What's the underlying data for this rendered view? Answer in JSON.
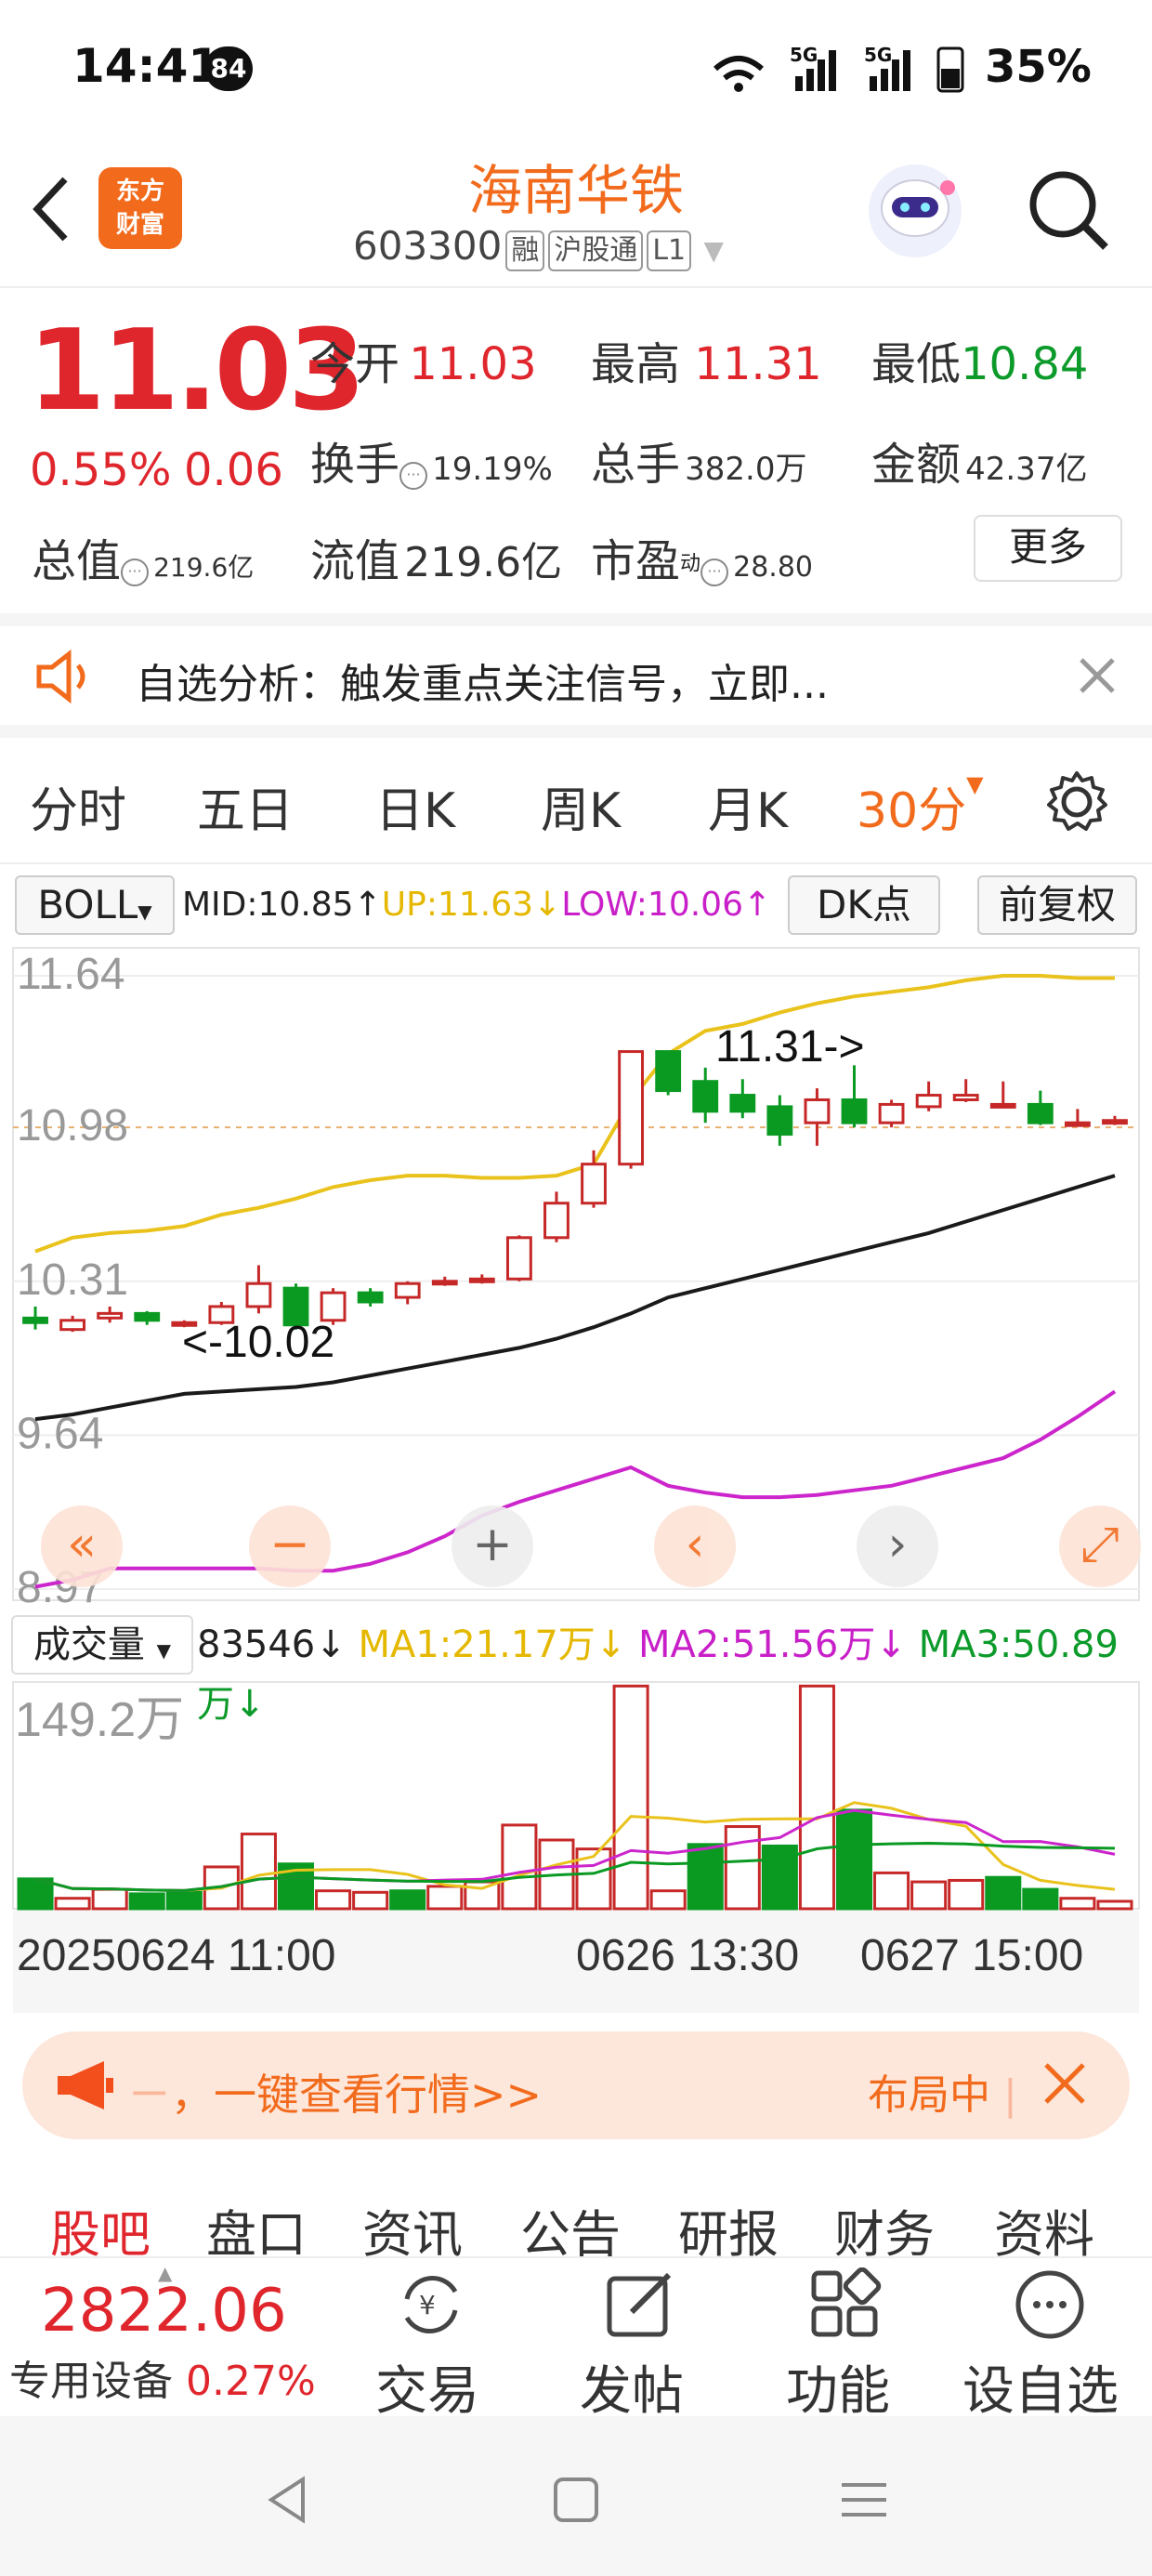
{
  "status_bar": {
    "time": "14:41",
    "notif_count": "84",
    "battery": "35%"
  },
  "header": {
    "logo_line1": "东方",
    "logo_line2": "财富",
    "name": "海南华铁",
    "code": "603300",
    "tags": [
      "融",
      "沪股通",
      "L1"
    ]
  },
  "quote": {
    "price": "11.03",
    "change_pct": "0.55%",
    "change": "0.06",
    "open_label": "今开",
    "open": "11.03",
    "high_label": "最高",
    "high": "11.31",
    "low_label": "最低",
    "low": "10.84",
    "turnover_label": "换手",
    "turnover": "19.19%",
    "volume_label": "总手",
    "volume": "382.0万",
    "amount_label": "金额",
    "amount": "42.37亿",
    "mktcap_label": "总值",
    "mktcap": "219.6亿",
    "float_label": "流值",
    "float": "219.6亿",
    "pe_label": "市盈",
    "pe_sup": "动",
    "pe": "28.80",
    "more_label": "更多"
  },
  "notice": {
    "text": "自选分析：触发重点关注信号，立即..."
  },
  "period_tabs": [
    "分时",
    "五日",
    "日K",
    "周K",
    "月K",
    "30分"
  ],
  "active_period": "30分",
  "indicator": {
    "name": "BOLL",
    "mid": "MID:10.85↑",
    "up": "UP:11.63↓",
    "low": "LOW:10.06↑",
    "dk": "DK点",
    "adjust": "前复权"
  },
  "volume_indicator": {
    "name": "成交量",
    "vol": "83546↓",
    "ma1": "MA1:21.17万↓",
    "ma2": "MA2:51.56万↓",
    "ma3": "MA3:50.89万↓",
    "max_label": "149.2万"
  },
  "chart_data": {
    "type": "candlestick",
    "y_ticks": [
      "11.64",
      "10.98",
      "10.31",
      "9.64",
      "8.97"
    ],
    "ylim": [
      8.97,
      11.64
    ],
    "annotations": [
      "11.31->",
      "<-10.02"
    ],
    "x_labels": [
      "20250624 11:00",
      "0626 13:30",
      "0627 15:00"
    ],
    "candles": [
      {
        "o": 10.15,
        "c": 10.13,
        "h": 10.2,
        "l": 10.1
      },
      {
        "o": 10.1,
        "c": 10.14,
        "h": 10.16,
        "l": 10.09
      },
      {
        "o": 10.15,
        "c": 10.17,
        "h": 10.2,
        "l": 10.13
      },
      {
        "o": 10.17,
        "c": 10.14,
        "h": 10.18,
        "l": 10.12
      },
      {
        "o": 10.13,
        "c": 10.13,
        "h": 10.14,
        "l": 10.11
      },
      {
        "o": 10.13,
        "c": 10.2,
        "h": 10.22,
        "l": 10.12
      },
      {
        "o": 10.2,
        "c": 10.3,
        "h": 10.38,
        "l": 10.17
      },
      {
        "o": 10.28,
        "c": 10.12,
        "h": 10.3,
        "l": 10.1
      },
      {
        "o": 10.14,
        "c": 10.26,
        "h": 10.28,
        "l": 10.12
      },
      {
        "o": 10.26,
        "c": 10.22,
        "h": 10.28,
        "l": 10.2
      },
      {
        "o": 10.24,
        "c": 10.3,
        "h": 10.31,
        "l": 10.21
      },
      {
        "o": 10.3,
        "c": 10.31,
        "h": 10.33,
        "l": 10.29
      },
      {
        "o": 10.31,
        "c": 10.32,
        "h": 10.34,
        "l": 10.3
      },
      {
        "o": 10.32,
        "c": 10.5,
        "h": 10.51,
        "l": 10.31
      },
      {
        "o": 10.5,
        "c": 10.65,
        "h": 10.7,
        "l": 10.48
      },
      {
        "o": 10.65,
        "c": 10.82,
        "h": 10.88,
        "l": 10.63
      },
      {
        "o": 10.82,
        "c": 11.31,
        "h": 11.31,
        "l": 10.8
      },
      {
        "o": 11.31,
        "c": 11.14,
        "h": 11.31,
        "l": 11.12
      },
      {
        "o": 11.18,
        "c": 11.05,
        "h": 11.24,
        "l": 11.0
      },
      {
        "o": 11.12,
        "c": 11.05,
        "h": 11.19,
        "l": 11.02
      },
      {
        "o": 11.07,
        "c": 10.95,
        "h": 11.12,
        "l": 10.9
      },
      {
        "o": 11.0,
        "c": 11.1,
        "h": 11.15,
        "l": 10.9
      },
      {
        "o": 11.1,
        "c": 11.0,
        "h": 11.25,
        "l": 10.98
      },
      {
        "o": 11.0,
        "c": 11.08,
        "h": 11.1,
        "l": 10.98
      },
      {
        "o": 11.07,
        "c": 11.12,
        "h": 11.18,
        "l": 11.05
      },
      {
        "o": 11.1,
        "c": 11.12,
        "h": 11.19,
        "l": 11.09
      },
      {
        "o": 11.08,
        "c": 11.08,
        "h": 11.18,
        "l": 11.07
      },
      {
        "o": 11.08,
        "c": 11.0,
        "h": 11.14,
        "l": 10.99
      },
      {
        "o": 11.0,
        "c": 11.0,
        "h": 11.06,
        "l": 10.99
      },
      {
        "o": 11.0,
        "c": 11.01,
        "h": 11.03,
        "l": 10.99
      }
    ],
    "boll_up": [
      10.44,
      10.5,
      10.52,
      10.53,
      10.55,
      10.6,
      10.63,
      10.67,
      10.72,
      10.75,
      10.77,
      10.77,
      10.76,
      10.76,
      10.77,
      10.82,
      11.1,
      11.3,
      11.4,
      11.43,
      11.48,
      11.52,
      11.55,
      11.57,
      11.59,
      11.62,
      11.64,
      11.64,
      11.63,
      11.63
    ],
    "boll_mid": [
      9.71,
      9.73,
      9.76,
      9.79,
      9.82,
      9.83,
      9.84,
      9.85,
      9.87,
      9.9,
      9.93,
      9.96,
      9.99,
      10.02,
      10.06,
      10.11,
      10.17,
      10.24,
      10.28,
      10.32,
      10.36,
      10.4,
      10.44,
      10.48,
      10.52,
      10.57,
      10.62,
      10.67,
      10.72,
      10.77
    ],
    "boll_low": [
      8.98,
      9.01,
      9.06,
      9.06,
      9.06,
      9.06,
      9.06,
      9.05,
      9.05,
      9.08,
      9.13,
      9.2,
      9.29,
      9.35,
      9.4,
      9.45,
      9.5,
      9.42,
      9.39,
      9.37,
      9.37,
      9.38,
      9.4,
      9.42,
      9.46,
      9.5,
      9.54,
      9.62,
      9.72,
      9.83
    ],
    "volume": [
      {
        "v": 20,
        "up": false
      },
      {
        "v": 7,
        "up": true
      },
      {
        "v": 13,
        "up": true
      },
      {
        "v": 10,
        "up": false
      },
      {
        "v": 11,
        "up": false
      },
      {
        "v": 28,
        "up": true
      },
      {
        "v": 50,
        "up": true
      },
      {
        "v": 30,
        "up": false
      },
      {
        "v": 12,
        "up": true
      },
      {
        "v": 11,
        "up": true
      },
      {
        "v": 12,
        "up": false
      },
      {
        "v": 15,
        "up": true
      },
      {
        "v": 18,
        "up": true
      },
      {
        "v": 56,
        "up": true
      },
      {
        "v": 46,
        "up": true
      },
      {
        "v": 40,
        "up": true
      },
      {
        "v": 149,
        "up": true
      },
      {
        "v": 12,
        "up": true
      },
      {
        "v": 43,
        "up": false
      },
      {
        "v": 55,
        "up": true
      },
      {
        "v": 42,
        "up": false
      },
      {
        "v": 149,
        "up": true
      },
      {
        "v": 66,
        "up": false
      },
      {
        "v": 24,
        "up": true
      },
      {
        "v": 18,
        "up": true
      },
      {
        "v": 19,
        "up": true
      },
      {
        "v": 21,
        "up": false
      },
      {
        "v": 13,
        "up": false
      },
      {
        "v": 7,
        "up": true
      },
      {
        "v": 5,
        "up": true
      }
    ],
    "vol_max": 149.2
  },
  "chart_controls": [
    "«",
    "−",
    "+",
    "‹",
    "›",
    "⤢"
  ],
  "banner": {
    "text": "，一键查看行情>>",
    "right": "布局中"
  },
  "bottom_tabs": [
    "股吧",
    "盘口",
    "资讯",
    "公告",
    "研报",
    "财务",
    "资料"
  ],
  "active_bottom_tab": "股吧",
  "bottom_bar": {
    "index_value": "2822.06",
    "index_name": "专用设备",
    "index_pct": "0.27%",
    "items": [
      "交易",
      "发帖",
      "功能",
      "设自选"
    ]
  }
}
